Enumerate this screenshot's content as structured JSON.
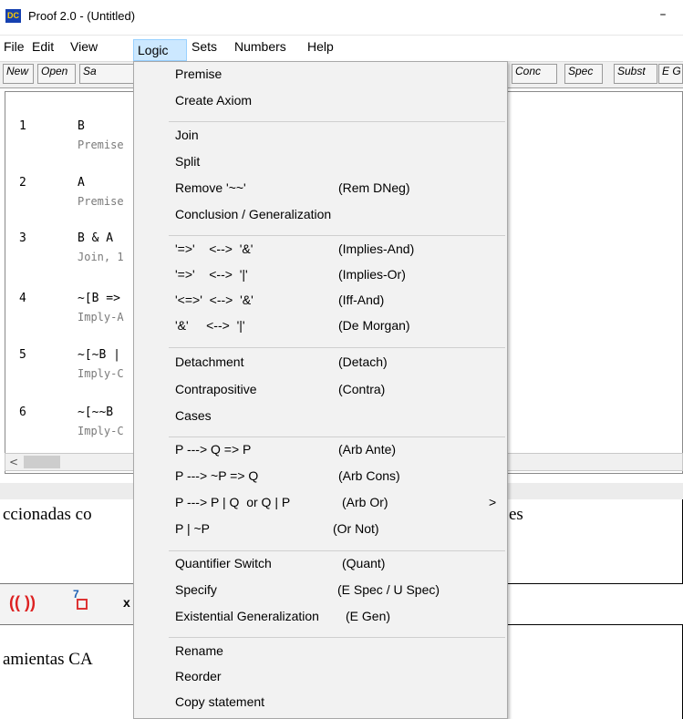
{
  "window": {
    "icon_text": "DC",
    "title": "Proof 2.0 - (Untitled)",
    "minimize": "–"
  },
  "menubar": [
    "File",
    "Edit",
    "View",
    "Logic",
    "Sets",
    "Numbers",
    "Help"
  ],
  "toolbar": {
    "left": [
      "New",
      "Open",
      "Sa"
    ],
    "right": [
      "Conc",
      "Spec",
      "Subst",
      "E G"
    ]
  },
  "proof_lines": [
    {
      "num": "1",
      "stmt": "B",
      "reason": "Premise"
    },
    {
      "num": "2",
      "stmt": "A",
      "reason": "Premise"
    },
    {
      "num": "3",
      "stmt": "B & A",
      "reason": "Join, 1"
    },
    {
      "num": "4",
      "stmt": "~[B =>",
      "reason": "Imply-A"
    },
    {
      "num": "5",
      "stmt": "~[~B |",
      "reason": "Imply-C"
    },
    {
      "num": "6",
      "stmt": "~[~~B",
      "reason": "Imply-C"
    }
  ],
  "scroll_left": "<",
  "background_doc": {
    "line1_left": "ccionadas co",
    "line1_right": "es",
    "line2_left": "amientas CA"
  },
  "tool_icons": [
    "(( ))",
    "7",
    "x"
  ],
  "logic_menu": {
    "groups": [
      [
        {
          "label": "Premise",
          "short": ""
        },
        {
          "label": "Create Axiom",
          "short": ""
        }
      ],
      [
        {
          "label": "Join",
          "short": ""
        },
        {
          "label": "Split",
          "short": ""
        },
        {
          "label": "Remove '~~'",
          "short": "(Rem DNeg)"
        },
        {
          "label": "Conclusion / Generalization",
          "short": ""
        }
      ],
      [
        {
          "label": "'=>'    <-->  '&'",
          "short": "(Implies-And)"
        },
        {
          "label": "'=>'    <-->  '|'",
          "short": "(Implies-Or)"
        },
        {
          "label": "'<=>'  <-->  '&'",
          "short": "(Iff-And)"
        },
        {
          "label": "'&'     <-->  '|'",
          "short": "(De Morgan)"
        }
      ],
      [
        {
          "label": "Detachment",
          "short": "(Detach)"
        },
        {
          "label": "Contrapositive",
          "short": "(Contra)"
        },
        {
          "label": "Cases",
          "short": ""
        }
      ],
      [
        {
          "label": "P ---> Q => P",
          "short": "(Arb Ante)"
        },
        {
          "label": "P ---> ~P => Q",
          "short": "(Arb Cons)"
        },
        {
          "label": "P ---> P | Q  or Q | P",
          "short": "(Arb Or)",
          "submenu": ">"
        },
        {
          "label": "P | ~P",
          "short": "(Or Not)"
        }
      ],
      [
        {
          "label": "Quantifier Switch",
          "short": "(Quant)"
        },
        {
          "label": "Specify",
          "short": "(E Spec / U Spec)"
        },
        {
          "label": "Existential Generalization",
          "short": "(E Gen)"
        }
      ],
      [
        {
          "label": "Rename",
          "short": ""
        },
        {
          "label": "Reorder",
          "short": ""
        },
        {
          "label": "Copy statement",
          "short": ""
        }
      ]
    ]
  },
  "colors": {
    "menu_highlight": "#cce8ff",
    "menu_bg": "#f2f2f2",
    "reason_text": "#7a7a7a",
    "app_icon": "#1540b0"
  }
}
